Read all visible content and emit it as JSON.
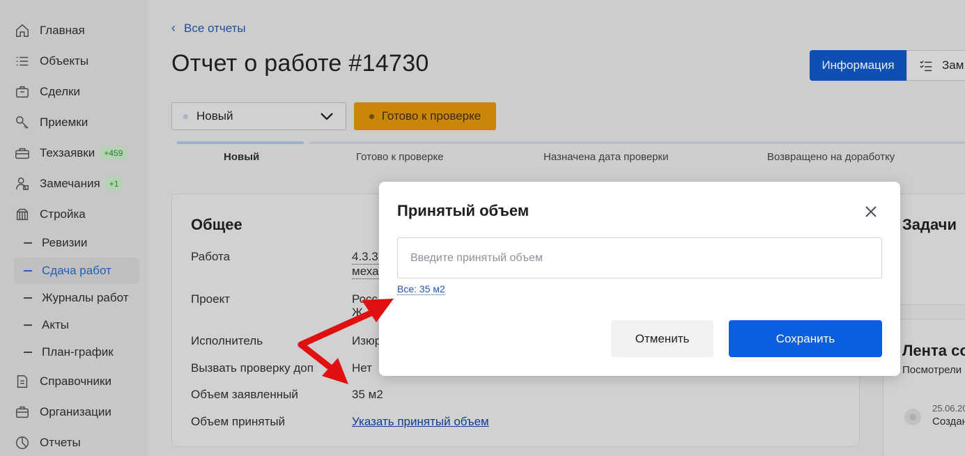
{
  "sidebar": {
    "items": [
      {
        "label": "Главная",
        "icon": "home-icon"
      },
      {
        "label": "Объекты",
        "icon": "list-icon"
      },
      {
        "label": "Сделки",
        "icon": "briefcase-icon"
      },
      {
        "label": "Приемки",
        "icon": "key-icon"
      },
      {
        "label": "Техзаявки",
        "icon": "toolbox-icon",
        "badge": "+459"
      },
      {
        "label": "Замечания",
        "icon": "inspector-icon",
        "badge": "+1"
      },
      {
        "label": "Стройка",
        "icon": "construction-icon"
      },
      {
        "label": "Справочники",
        "icon": "document-icon"
      },
      {
        "label": "Организации",
        "icon": "organization-icon"
      },
      {
        "label": "Отчеты",
        "icon": "pie-chart-icon"
      }
    ],
    "sub_items": [
      {
        "label": "Ревизии",
        "active": false
      },
      {
        "label": "Сдача работ",
        "active": true
      },
      {
        "label": "Журналы работ",
        "active": false
      },
      {
        "label": "Акты",
        "active": false
      },
      {
        "label": "План-график",
        "active": false
      }
    ]
  },
  "header": {
    "back_label": "Все отчеты",
    "title": "Отчет о работе #14730",
    "tabs": [
      {
        "label": "Информация",
        "active": true
      },
      {
        "label": "Зам",
        "active": false
      }
    ]
  },
  "status": {
    "current": "Новый",
    "next_action": "Готово к проверке",
    "stages": [
      "Новый",
      "Готово к проверке",
      "Назначена дата проверки",
      "Возвращено на доработку"
    ]
  },
  "general": {
    "title": "Общее",
    "rows": [
      {
        "label": "Работа",
        "value": "4.3.3.",
        "value2": "меха"
      },
      {
        "label": "Проект",
        "value": "Росс",
        "value2": "Ж"
      },
      {
        "label": "Исполнитель",
        "value": "Изюр"
      },
      {
        "label": "Вызвать проверку доп",
        "value": "Нет"
      },
      {
        "label": "Объем заявленный",
        "value": "35 м2"
      },
      {
        "label": "Объем принятый",
        "value": "Указать принятый объем"
      }
    ]
  },
  "side": {
    "tasks_title": "Задачи",
    "feed_title": "Лента со",
    "feed_sub": "Посмотрели",
    "feed_date": "25.06.20",
    "feed_text": "Создан"
  },
  "modal": {
    "title": "Принятый объем",
    "input_value": "",
    "input_placeholder": "Введите принятый объем",
    "all_link": "Все: 35 м2",
    "cancel_label": "Отменить",
    "save_label": "Сохранить"
  },
  "colors": {
    "primary": "#0a5ee0",
    "tab_active": "#0d4fb3",
    "warning": "#c98607",
    "annotation_arrow": "#e01010"
  }
}
